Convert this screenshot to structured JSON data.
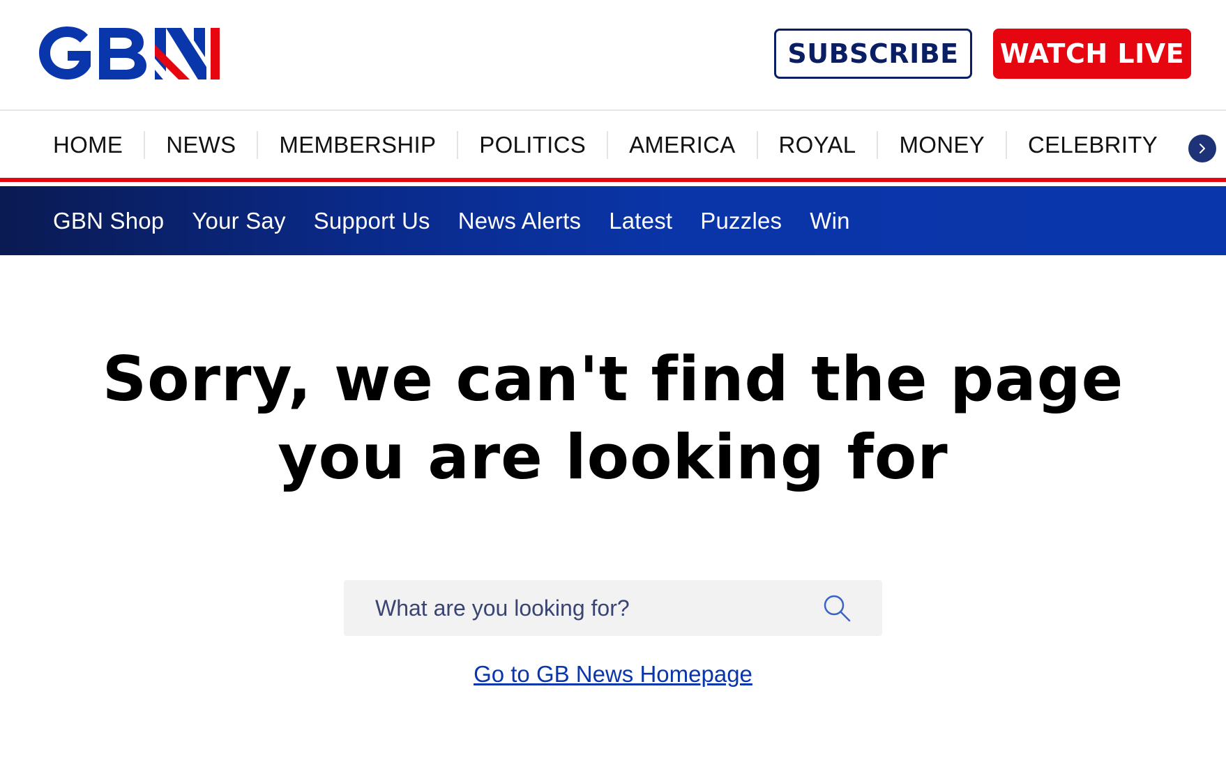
{
  "header": {
    "logo_text": "GBN",
    "subscribe_label": "SUBSCRIBE",
    "watch_live_label": "WATCH LIVE"
  },
  "primary_nav": {
    "items": [
      "HOME",
      "NEWS",
      "MEMBERSHIP",
      "POLITICS",
      "AMERICA",
      "ROYAL",
      "MONEY",
      "CELEBRITY"
    ],
    "next_icon": "chevron-right-icon"
  },
  "secondary_nav": {
    "items": [
      "GBN Shop",
      "Your Say",
      "Support Us",
      "News Alerts",
      "Latest",
      "Puzzles",
      "Win"
    ]
  },
  "main": {
    "title_line1": "Sorry, we can't find the page",
    "title_line2": "you are looking for",
    "search_placeholder": "What are you looking for?",
    "search_icon": "search-icon",
    "home_link": "Go to GB News Homepage"
  },
  "colors": {
    "brand_blue": "#0a36ac",
    "brand_navy": "#0a1f63",
    "brand_red": "#e5060f"
  }
}
